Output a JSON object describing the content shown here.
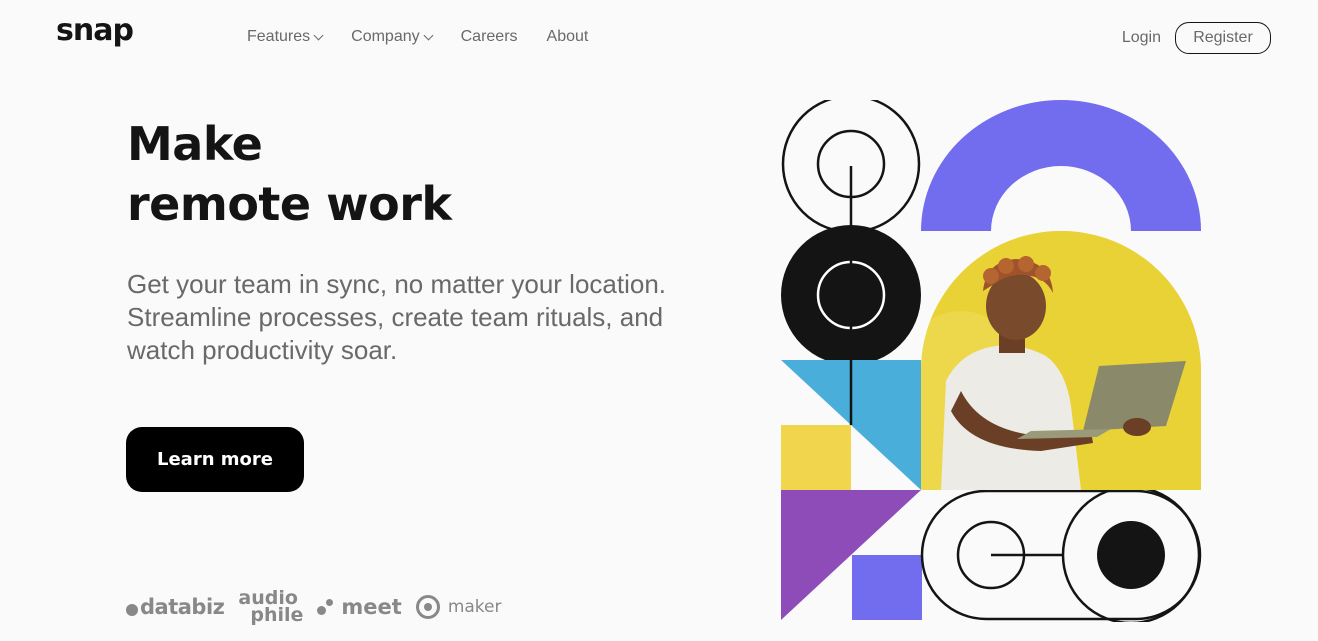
{
  "brand": {
    "logo": "snap"
  },
  "nav": {
    "items": [
      {
        "label": "Features",
        "dropdown": true
      },
      {
        "label": "Company",
        "dropdown": true
      },
      {
        "label": "Careers",
        "dropdown": false
      },
      {
        "label": "About",
        "dropdown": false
      }
    ]
  },
  "auth": {
    "login_label": "Login",
    "register_label": "Register"
  },
  "hero": {
    "title_line1": "Make",
    "title_line2": "remote work",
    "description": "Get your team in sync, no matter your location. Streamline processes, create team rituals, and watch productivity soar.",
    "cta_label": "Learn more"
  },
  "clients": {
    "databiz": "databiz",
    "audiophile_top": "audio",
    "audiophile_bottom": "phile",
    "meet": "meet",
    "maker": "maker"
  },
  "colors": {
    "background": "#fafafa",
    "text": "#141414",
    "muted": "#696969",
    "purple": "#726cee",
    "yellow": "#e8d033",
    "blue": "#4aaedb",
    "violet": "#8e4cb8"
  }
}
